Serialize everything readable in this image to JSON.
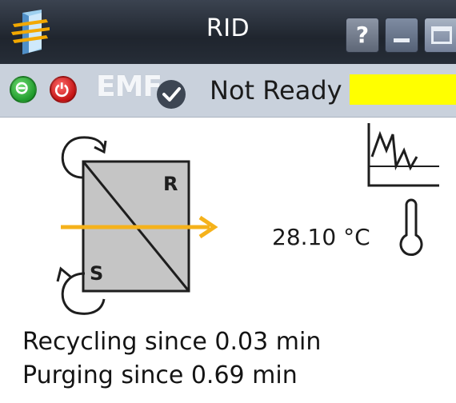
{
  "window": {
    "title": "RID",
    "help_label": "?"
  },
  "status": {
    "emf_label": "EMF",
    "state_text": "Not Ready",
    "state_color": "#ffff00"
  },
  "diagram": {
    "valve_label_r": "R",
    "valve_label_s": "S",
    "flow_color": "#f5b21b"
  },
  "temperature": {
    "value": "28.10",
    "unit": "°C"
  },
  "info": {
    "recycling": "Recycling since 0.03 min",
    "purging": "Purging since 0.69 min"
  }
}
